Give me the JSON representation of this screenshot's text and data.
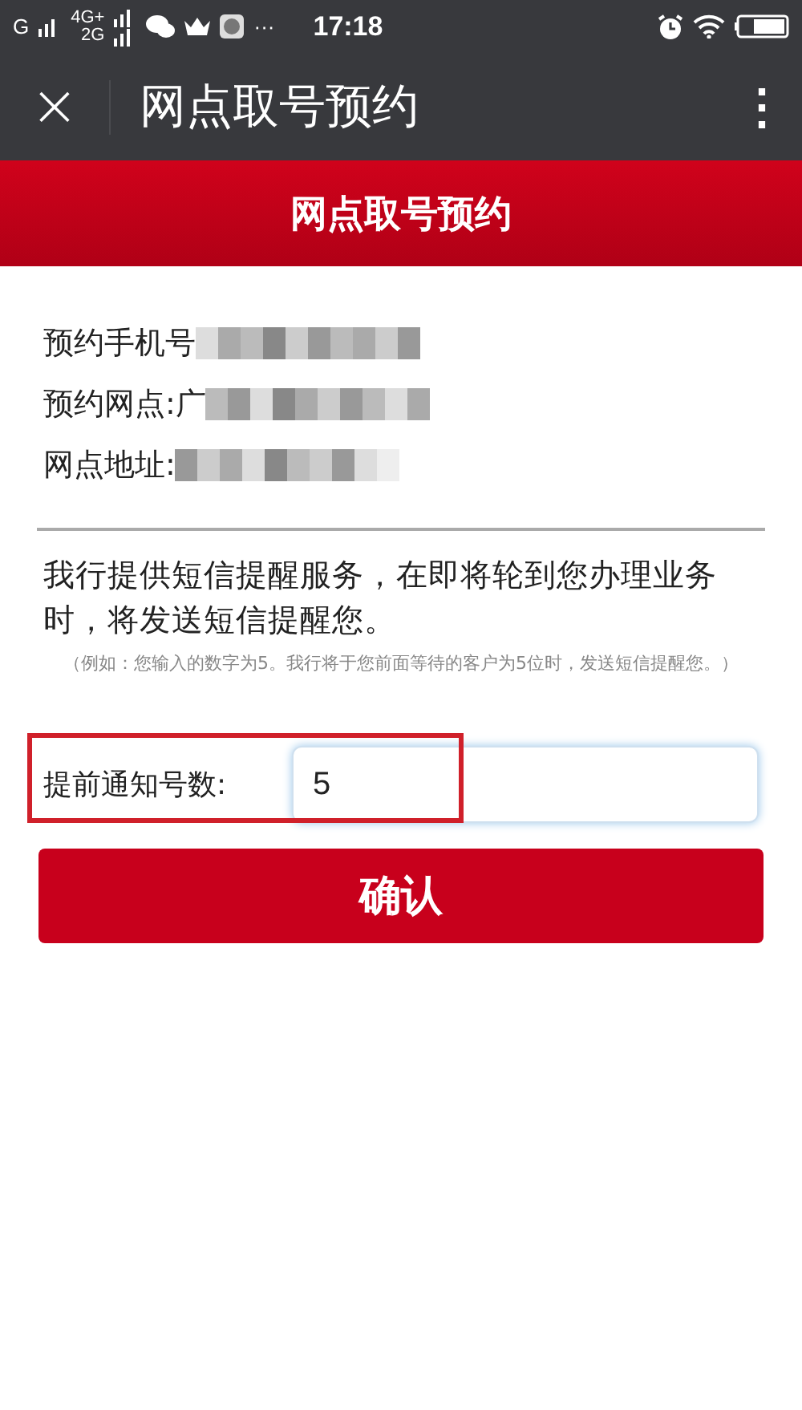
{
  "status_bar": {
    "signal_1": "G",
    "signal_2_top": "4G+",
    "signal_2_bottom": "2G",
    "more": "···",
    "time": "17:18"
  },
  "app_bar": {
    "close": "×",
    "title": "网点取号预约",
    "menu": "⋮"
  },
  "banner": {
    "title": "网点取号预约"
  },
  "details": [
    {
      "label": "预约手机号",
      "redacted": true
    },
    {
      "label": "预约网点:广",
      "redacted": true
    },
    {
      "label": "网点地址:",
      "redacted": true
    }
  ],
  "notice": "我行提供短信提醒服务，在即将轮到您办理业务时，将发送短信提醒您。",
  "example": "（例如：您输入的数字为5。我行将于您前面等待的客户为5位时，发送短信提醒您。）",
  "advance_notice": {
    "label": "提前通知号数:",
    "value": "5",
    "annotation_box": true
  },
  "confirm_button": "确认"
}
